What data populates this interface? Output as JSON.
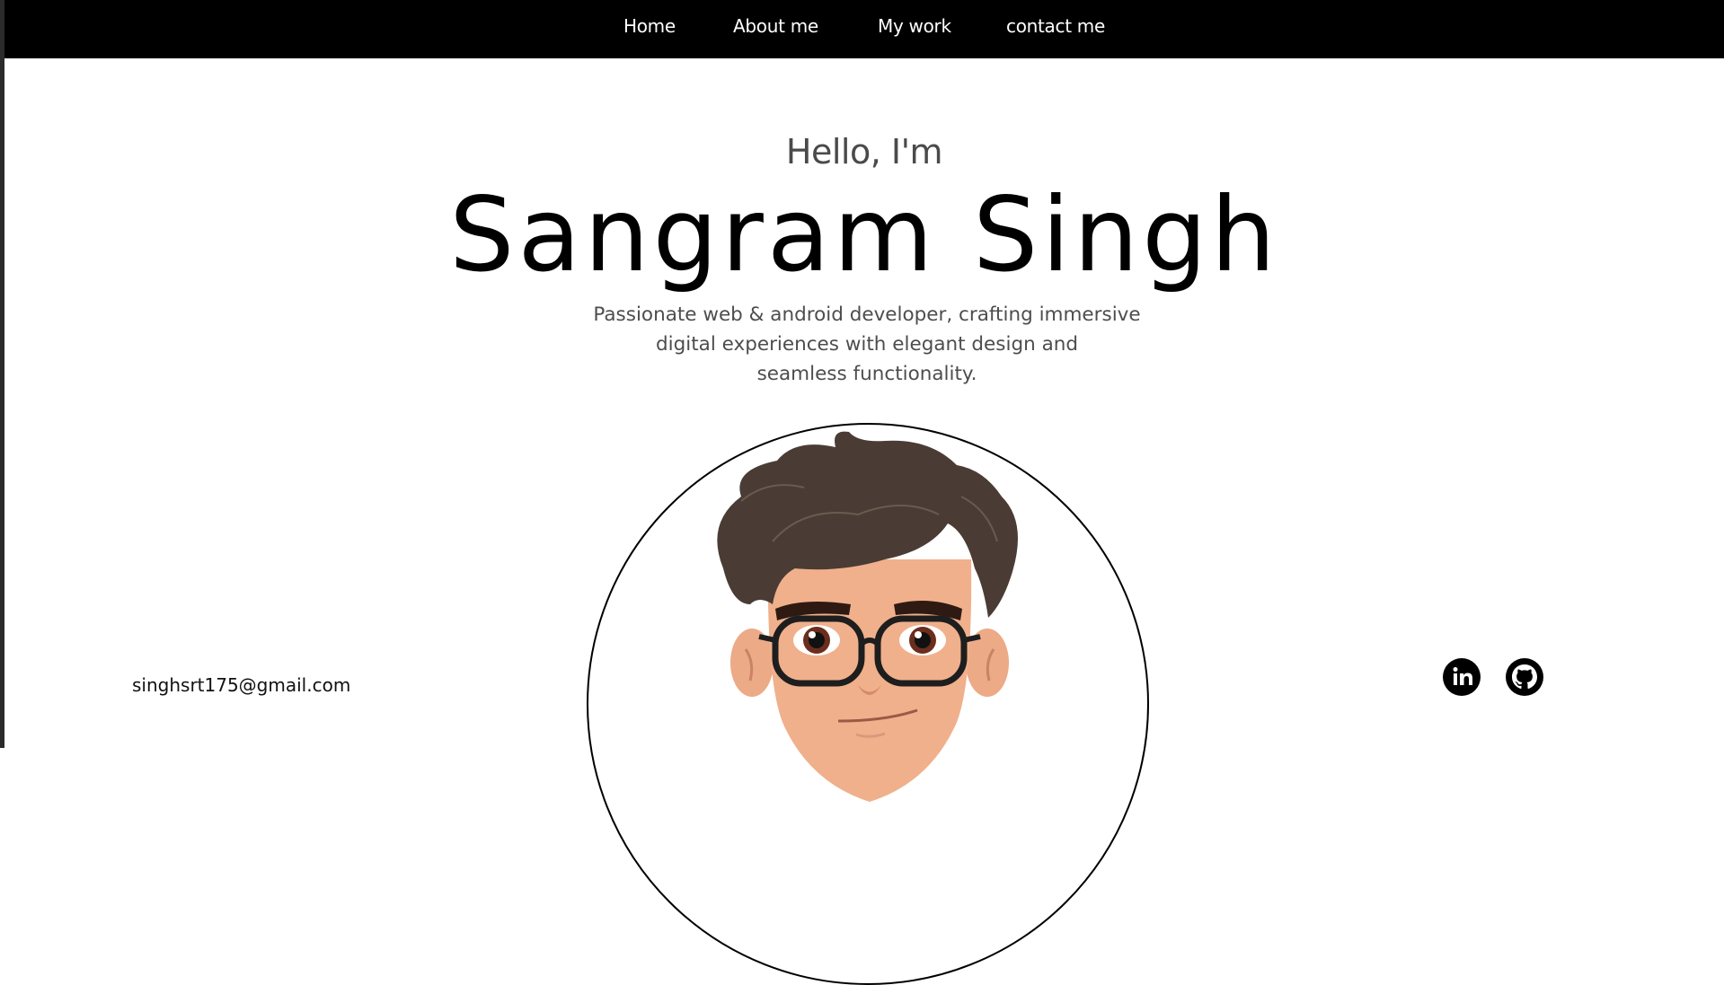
{
  "nav": {
    "items": [
      {
        "label": "Home"
      },
      {
        "label": "About me"
      },
      {
        "label": "My work"
      },
      {
        "label": "contact me"
      }
    ]
  },
  "hero": {
    "greeting": "Hello, I'm",
    "name": "Sangram Singh",
    "tagline": [
      "Passionate web & android developer, crafting immersive",
      "digital experiences with elegant design and",
      "seamless functionality."
    ]
  },
  "footer": {
    "email": "singhsrt175@gmail.com",
    "social": [
      {
        "icon": "linkedin-icon"
      },
      {
        "icon": "github-icon"
      }
    ]
  },
  "colors": {
    "nav_bg": "#000000",
    "nav_text": "#ffffff",
    "name_text": "#000000",
    "subtext": "#4d4d4d",
    "hair": "#4a3c34",
    "skin": "#f0b08c"
  }
}
